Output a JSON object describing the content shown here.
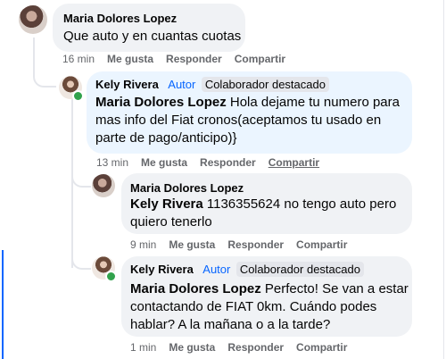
{
  "comments": [
    {
      "author": "Maria Dolores Lopez",
      "text": "Que auto y en cuantas cuotas",
      "time": "16 min",
      "like": "Me gusta",
      "reply": "Responder",
      "share": "Compartir"
    },
    {
      "author": "Kely Rivera",
      "author_tag": "Autor",
      "badge": "Colaborador destacado",
      "mention": "Maria Dolores Lopez",
      "text_line1": " Hola dejame tu numero para",
      "text_line2": "mas info del Fiat cronos(aceptamos tu usado en",
      "text_line3": "parte de pago/anticipo)}",
      "time": "13 min",
      "like": "Me gusta",
      "reply": "Responder",
      "share": "Compartir"
    },
    {
      "author": "Maria Dolores Lopez",
      "mention": "Kely Rivera",
      "text_line1": " 1136355624 no tengo auto pero",
      "text_line2": "quiero tenerlo",
      "time": "9 min",
      "like": "Me gusta",
      "reply": "Responder",
      "share": "Compartir"
    },
    {
      "author": "Kely Rivera",
      "author_tag": "Autor",
      "badge": "Colaborador destacado",
      "mention": "Maria Dolores Lopez",
      "text_line1": " Perfecto! Se van a estar",
      "text_line2": "contactando de FIAT 0km. Cuándo podes",
      "text_line3": "hablar? A la mañana o a la tarde?",
      "time": "1 min",
      "like": "Me gusta",
      "reply": "Responder",
      "share": "Compartir"
    }
  ],
  "colors": {
    "bubble_gray": "#f0f2f5",
    "bubble_blue": "#ebf5ff",
    "author_tag": "#0866ff",
    "meta_text": "#65676b",
    "online": "#31a24c"
  }
}
